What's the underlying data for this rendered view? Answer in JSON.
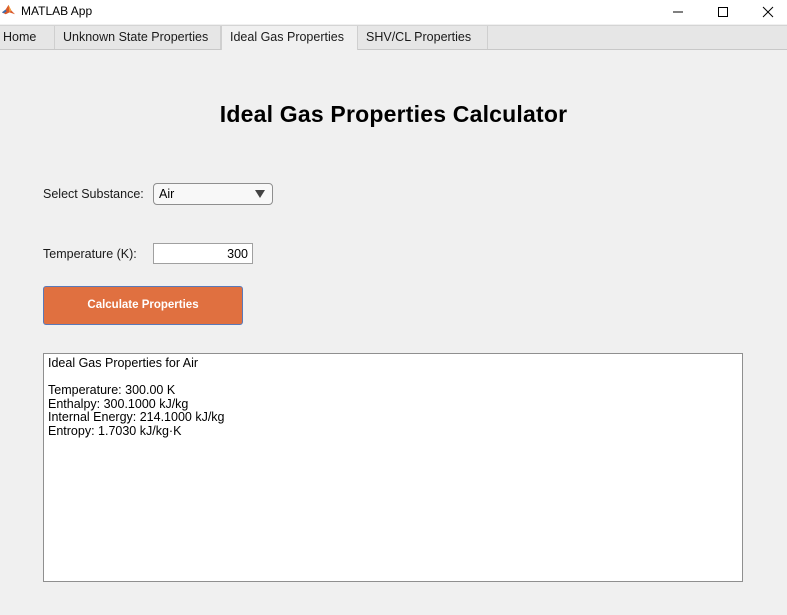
{
  "window": {
    "title": "MATLAB App",
    "icon": "matlab-logo-icon",
    "controls": {
      "minimize_icon": "minimize-icon",
      "maximize_icon": "maximize-icon",
      "close_icon": "close-icon"
    }
  },
  "tabs": [
    {
      "label": "Home",
      "active": false
    },
    {
      "label": "Unknown State Properties",
      "active": false
    },
    {
      "label": "Ideal Gas Properties",
      "active": true
    },
    {
      "label": "SHV/CL Properties",
      "active": false
    }
  ],
  "main": {
    "title": "Ideal Gas Properties Calculator",
    "substance": {
      "label": "Select Substance:",
      "value": "Air"
    },
    "temperature": {
      "label": "Temperature (K):",
      "value": "300"
    },
    "calculate_button": {
      "label": "Calculate Properties",
      "color": "#e07040"
    },
    "output_lines": [
      "Ideal Gas Properties for Air",
      "",
      "Temperature: 300.00 K",
      "Enthalpy: 300.1000 kJ/kg",
      "Internal Energy: 214.1000 kJ/kg",
      "Entropy: 1.7030 kJ/kg·K"
    ]
  }
}
